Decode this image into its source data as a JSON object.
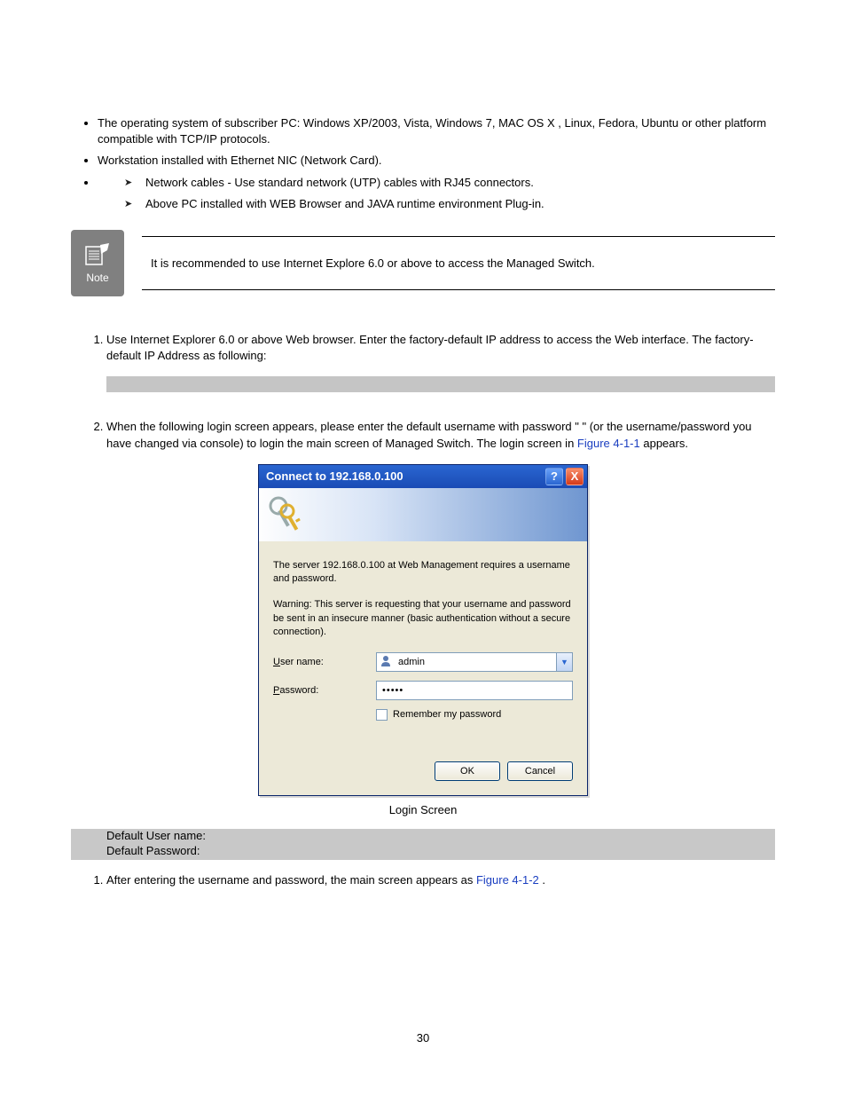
{
  "bullets": {
    "b1": "The operating system of subscriber PC: Windows XP/2003, Vista, Windows 7, MAC OS X , Linux, Fedora, Ubuntu or other platform compatible with TCP/IP protocols.",
    "b2": "Workstation installed with Ethernet NIC (Network Card).",
    "s1": "Network cables - Use standard network (UTP) cables with RJ45 connectors.",
    "s2": "Above PC installed with WEB Browser and JAVA runtime environment Plug-in."
  },
  "note": {
    "label": "Note",
    "text": "It is recommended to use Internet Explore 6.0 or above to access the Managed Switch."
  },
  "steps_a": {
    "n1": "Use Internet Explorer 6.0 or above Web browser. Enter the factory-default IP address to access the Web interface. The factory-default IP Address as following:",
    "n2_a": "When the following login screen appears, please enter the default username ",
    "n2_b": " with password \" ",
    "n2_c": " \" (or the username/password you have changed via console) to login the main screen of Managed Switch. The login screen in ",
    "n2_link": "Figure 4-1-1",
    "n2_d": " appears."
  },
  "dialog": {
    "title": "Connect to 192.168.0.100",
    "help": "?",
    "close": "X",
    "msg1": "The server 192.168.0.100 at Web Management requires a username and password.",
    "msg2": "Warning: This server is requesting that your username and password be sent in an insecure manner (basic authentication without a secure connection).",
    "user_label_u": "U",
    "user_label_rest": "ser name:",
    "user_value": "admin",
    "pass_label_u": "P",
    "pass_label_rest": "assword:",
    "pass_value": "•••••",
    "remember_u": "R",
    "remember_rest": "emember my password",
    "ok": "OK",
    "cancel": "Cancel",
    "dropdown_arrow": "▼"
  },
  "caption": "Login Screen",
  "defaults": {
    "line1": "Default User name:",
    "line2": "Default Password:"
  },
  "steps_b": {
    "n1_a": "After entering the username and password, the main screen appears as ",
    "n1_link": "Figure 4-1-2",
    "n1_b": "."
  },
  "page_number": "30"
}
